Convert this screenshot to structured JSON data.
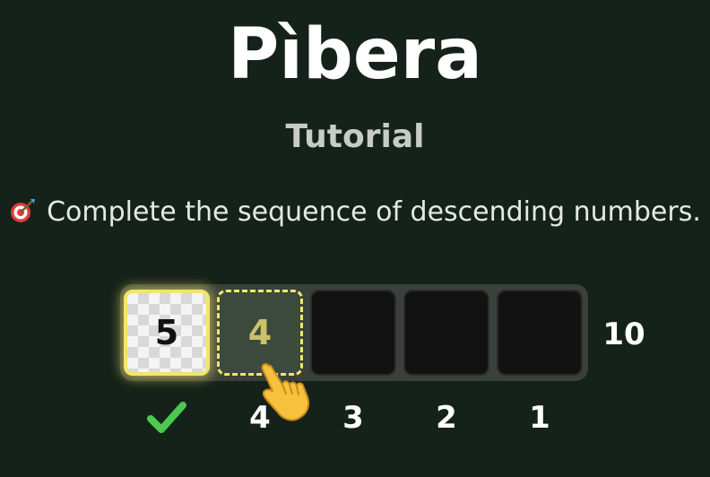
{
  "title": "Pìbera",
  "subtitle": "Tutorial",
  "instruction": {
    "icon": "target-icon",
    "text": "Complete the sequence of descending numbers."
  },
  "sequence": {
    "tiles": [
      {
        "state": "filled",
        "value": "5"
      },
      {
        "state": "active",
        "value": "4"
      },
      {
        "state": "empty",
        "value": ""
      },
      {
        "state": "empty",
        "value": ""
      },
      {
        "state": "empty",
        "value": ""
      }
    ],
    "total": "10"
  },
  "labels": {
    "first": "check-icon",
    "second": "4",
    "third": "3",
    "fourth": "2",
    "fifth": "1"
  },
  "pointer": "pointing-hand-icon",
  "colors": {
    "background": "#15221a",
    "highlight": "#f3e56b",
    "check": "#4cc94f"
  }
}
